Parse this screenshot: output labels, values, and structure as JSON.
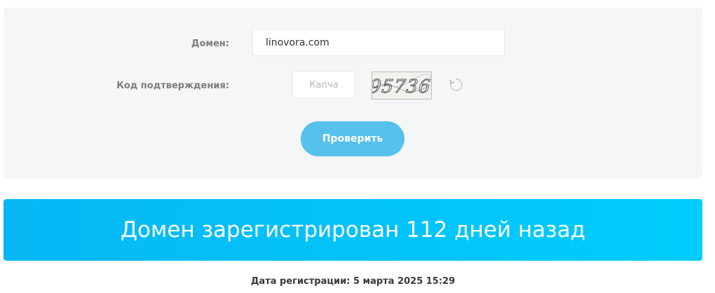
{
  "form": {
    "domain_label": "Домен:",
    "domain_value": "linovora.com",
    "captcha_label": "Код подтверждения:",
    "captcha_placeholder": "Капча",
    "captcha_code": "95736",
    "refresh_icon": "refresh-icon",
    "check_button": "Проверить"
  },
  "result": {
    "headline": "Домен зарегистрирован 112 дней назад",
    "registration_date": "Дата регистрации: 5 марта 2025 15:29"
  },
  "colors": {
    "panel_bg": "#f4f6f7",
    "button_bg": "#55c1ec",
    "banner_start": "#07b7f5",
    "banner_end": "#00cdfd"
  }
}
